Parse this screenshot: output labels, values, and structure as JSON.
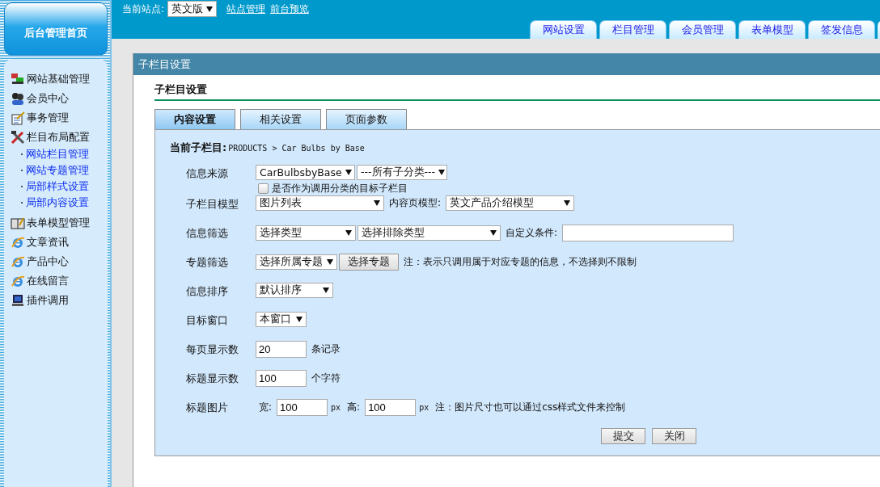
{
  "home_button": "后台管理首页",
  "site_bar": {
    "label": "当前站点:",
    "site_select": "英文版",
    "links": [
      "站点管理",
      "前台预览"
    ]
  },
  "nav_tabs": [
    {
      "label": "网站设置"
    },
    {
      "label": "栏目管理"
    },
    {
      "label": "会员管理"
    },
    {
      "label": "表单模型"
    },
    {
      "label": "签发信息"
    }
  ],
  "sidebar": [
    {
      "label": "网站基础管理"
    },
    {
      "label": "会员中心"
    },
    {
      "label": "事务管理"
    },
    {
      "label": "栏目布局配置",
      "children": [
        {
          "label": "网站栏目管理"
        },
        {
          "label": "网站专题管理"
        },
        {
          "label": "局部样式设置"
        },
        {
          "label": "局部内容设置"
        }
      ]
    },
    {
      "label": "表单模型管理"
    },
    {
      "label": "文章资讯"
    },
    {
      "label": "产品中心"
    },
    {
      "label": "在线留言"
    },
    {
      "label": "插件调用"
    }
  ],
  "dialog": {
    "title": "子栏目设置",
    "heading": "子栏目设置",
    "tabs": [
      {
        "label": "内容设置",
        "selected": true
      },
      {
        "label": "相关设置",
        "selected": false
      },
      {
        "label": "页面参数",
        "selected": false
      }
    ],
    "current": {
      "label": "当前子栏目:",
      "path": "PRODUCTS > Car Bulbs by Base"
    },
    "rows": [
      {
        "label": "信息来源",
        "items": [
          {
            "kind": "select",
            "value": "CarBulbsbyBase"
          },
          {
            "kind": "select",
            "value": "---所有子分类---"
          },
          {
            "kind": "checkbox",
            "text": "是否作为调用分类的目标子栏目",
            "checked": false
          }
        ]
      },
      {
        "label": "子栏目模型",
        "items": [
          {
            "kind": "select",
            "value": "图片列表"
          },
          {
            "kind": "text",
            "text": "内容页模型:"
          },
          {
            "kind": "select",
            "value": "英文产品介绍模型"
          }
        ]
      },
      {
        "label": "信息筛选",
        "items": [
          {
            "kind": "select",
            "value": "选择类型"
          },
          {
            "kind": "select",
            "value": "选择排除类型"
          },
          {
            "kind": "text",
            "text": "自定义条件:"
          },
          {
            "kind": "input"
          }
        ]
      },
      {
        "label": "专题筛选",
        "items": [
          {
            "kind": "select",
            "value": "选择所属专题"
          },
          {
            "kind": "button",
            "text": "选择专题"
          },
          {
            "kind": "text",
            "text": "注：表示只调用属于对应专题的信息，不选择则不限制"
          }
        ]
      },
      {
        "label": "信息排序",
        "items": [
          {
            "kind": "select",
            "value": "默认排序"
          }
        ]
      },
      {
        "label": "目标窗口",
        "items": [
          {
            "kind": "select",
            "value": "本窗口"
          }
        ]
      },
      {
        "label": "每页显示数",
        "items": [
          {
            "kind": "input",
            "value": "20"
          },
          {
            "kind": "text",
            "text": "条记录"
          }
        ]
      },
      {
        "label": "标题显示数",
        "items": [
          {
            "kind": "input",
            "value": "100"
          },
          {
            "kind": "text",
            "text": "个字符"
          }
        ]
      },
      {
        "label": "标题图片",
        "items": [
          {
            "kind": "text",
            "text": "宽:"
          },
          {
            "kind": "input",
            "value": "100"
          },
          {
            "kind": "unit",
            "text": "px"
          },
          {
            "kind": "text",
            "text": "高:"
          },
          {
            "kind": "input",
            "value": "100"
          },
          {
            "kind": "unit",
            "text": "px"
          },
          {
            "kind": "text",
            "text": "注：图片尺寸也可以通过css样式文件来控制"
          }
        ]
      }
    ],
    "buttons": [
      "提交",
      "关闭"
    ]
  }
}
